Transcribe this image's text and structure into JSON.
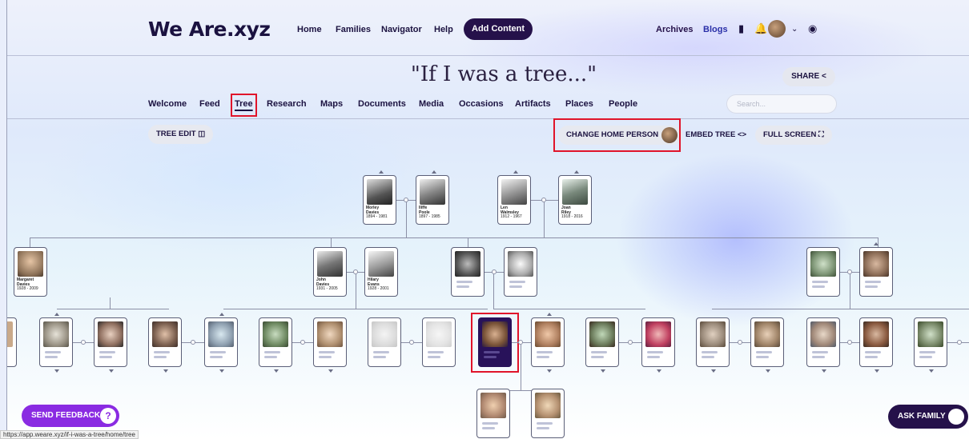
{
  "nav": {
    "logo": "We Are.xyz",
    "links": [
      "Home",
      "Families",
      "Navigator",
      "Help"
    ],
    "add_content": "Add Content",
    "archives": "Archives",
    "blogs": "Blogs",
    "icons": [
      "bookmark-icon",
      "bell-icon",
      "avatar",
      "chevron-down-icon",
      "lightbulb-icon"
    ]
  },
  "page": {
    "title": "\"If I was a tree...\"",
    "share": "SHARE",
    "search_placeholder": "Search..."
  },
  "tabs": [
    "Welcome",
    "Feed",
    "Tree",
    "Research",
    "Maps",
    "Documents",
    "Media",
    "Occasions",
    "Artifacts",
    "Places",
    "People"
  ],
  "active_tab": "Tree",
  "toolbar": {
    "tree_edit": "TREE EDIT",
    "change_home_person": "CHANGE HOME PERSON",
    "embed_tree": "EMBED TREE",
    "full_screen": "FULL SCREEN"
  },
  "people": {
    "morley": {
      "first": "Morley",
      "last": "Davies",
      "years": "1894 - 1981"
    },
    "iliffe": {
      "first": "Iliffe",
      "last": "Poole",
      "years": "1897 - 1985"
    },
    "len": {
      "first": "Len",
      "last": "Walmsley",
      "years": "1912 - 1967"
    },
    "joan": {
      "first": "Joan",
      "last": "Riley",
      "years": "1918 - 2016"
    },
    "margaret": {
      "first": "Margaret",
      "last": "Davies",
      "years": "1928 - 2009"
    },
    "john": {
      "first": "John",
      "last": "Davies",
      "years": "1931 - 2005"
    },
    "hilary": {
      "first": "Hilary",
      "last": "Evans",
      "years": "1928 - 2001"
    }
  },
  "bottom": {
    "send_feedback": "SEND FEEDBACK",
    "ask_family": "ASK FAMILY",
    "status_url": "https://app.weare.xyz/if-i-was-a-tree/home/tree"
  },
  "colors": {
    "accent": "#25114a",
    "feedback": "#8a2be2",
    "highlight": "#e0142a",
    "link_blue": "#2a2fa8"
  }
}
